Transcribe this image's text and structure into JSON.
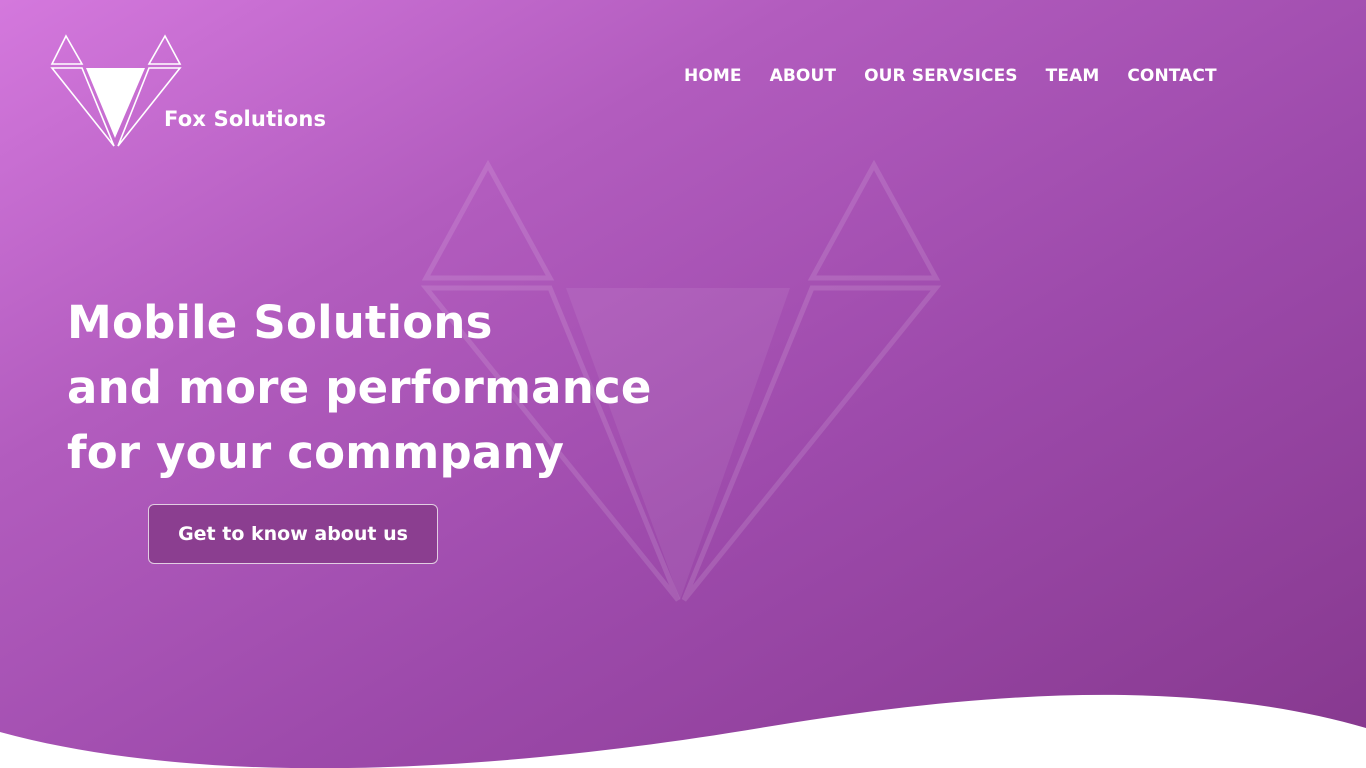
{
  "brand": {
    "name": "Fox Solutions"
  },
  "nav": {
    "items": [
      {
        "label": "HOME"
      },
      {
        "label": "ABOUT"
      },
      {
        "label": "OUR SERVSICES"
      },
      {
        "label": "TEAM"
      },
      {
        "label": "CONTACT"
      }
    ]
  },
  "hero": {
    "headline_lines": [
      "Mobile Solutions",
      "and more performance",
      "for your commpany"
    ],
    "cta_label": "Get to know about us"
  },
  "colors": {
    "gradient_start": "#d478dd",
    "gradient_end": "#86388e",
    "button_bg": "#8b3e90",
    "text": "#ffffff"
  },
  "icons": [
    "fox-logo-icon",
    "fox-watermark-icon"
  ]
}
